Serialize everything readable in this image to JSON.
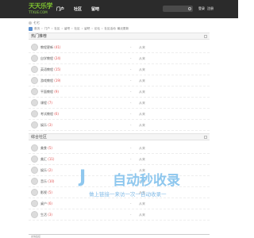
{
  "header": {
    "logo_main": "天天乐学",
    "logo_sub": "TTXUE.COM",
    "nav": [
      "门户",
      "社区",
      "留吧"
    ],
    "user_links": [
      "登录",
      "注册"
    ]
  },
  "user_bar": {
    "text": "  七七"
  },
  "breadcrumb": [
    "首页",
    "门户",
    "社区",
    "留吧",
    "社区",
    "留吧",
    "论坛",
    "社区活动",
    "最近更新"
  ],
  "sections": [
    {
      "title": "热门推荐",
      "forums": [
        {
          "name": "教程更新",
          "count": "(41)",
          "last": "从来"
        },
        {
          "name": "自学教程",
          "count": "(24)",
          "last": "从来"
        },
        {
          "name": "英语教程",
          "count": "(15)",
          "last": "从来"
        },
        {
          "name": "游戏教程",
          "count": "(19)",
          "last": "从来"
        },
        {
          "name": "平面教程",
          "count": "(9)",
          "last": "从来"
        },
        {
          "name": "课程",
          "count": "(7)",
          "last": "从来"
        },
        {
          "name": "考试教程",
          "count": "(6)",
          "last": "从来"
        },
        {
          "name": "娱乐",
          "count": "(3)",
          "last": "从来"
        }
      ]
    },
    {
      "title": "综合社区",
      "forums": [
        {
          "name": "美食",
          "count": "(5)",
          "last": "从来"
        },
        {
          "name": "美汇",
          "count": "(11)",
          "last": "从来"
        },
        {
          "name": "娱乐",
          "count": "(2)",
          "last": "从来"
        },
        {
          "name": "音乐",
          "count": "(10)",
          "last": "从来"
        },
        {
          "name": "影视",
          "count": "(5)",
          "last": "从来"
        },
        {
          "name": "桌户",
          "count": "(6)",
          "last": "从来"
        },
        {
          "name": "生活",
          "count": "(3)",
          "last": "从来"
        }
      ]
    }
  ],
  "forum_dash": "-",
  "watermark": {
    "jr": "J",
    "main": "自动秒收录",
    "sub": "做上链接一来访一次一自动收录一"
  },
  "footer": {
    "label": "友情链接"
  }
}
